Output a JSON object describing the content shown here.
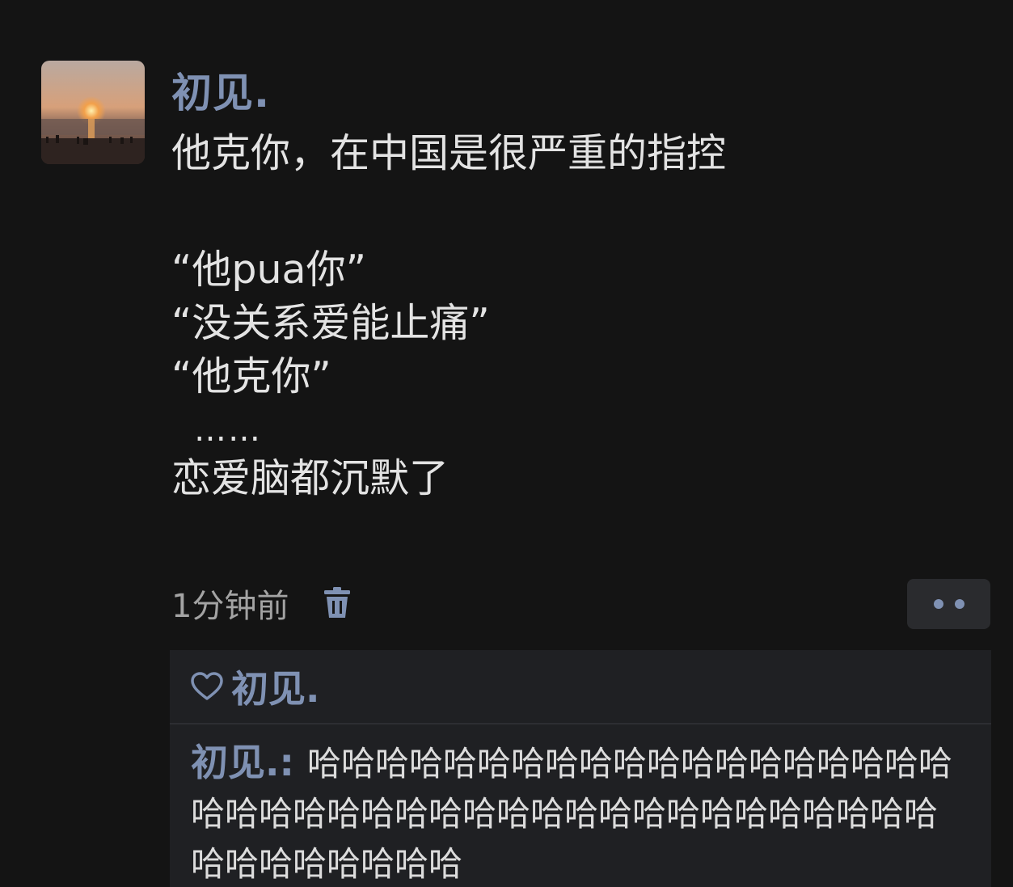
{
  "post": {
    "author": "初见.",
    "lines": [
      "他克你，在中国是很严重的指控",
      "",
      "“他pua你”",
      "“没关系爱能止痛”",
      "“他克你”",
      "……",
      "恋爱脑都沉默了"
    ],
    "timestamp": "1分钟前"
  },
  "likes": {
    "names": "初见."
  },
  "comment": {
    "author": "初见.",
    "separator": ": ",
    "text": "哈哈哈哈哈哈哈哈哈哈哈哈哈哈哈哈哈哈哈哈哈哈哈哈哈哈哈哈哈哈哈哈哈哈哈哈哈哈哈哈哈哈哈哈哈哈哈哈哈"
  },
  "colors": {
    "background": "#141414",
    "name_accent": "#7f91b3",
    "body_text": "#e3e3e3",
    "meta_text": "#a3a3a3",
    "reaction_panel": "#1f2023"
  },
  "icons": {
    "avatar": "sunset-photo",
    "delete": "trash-icon",
    "more": "ellipsis-icon",
    "like": "heart-outline-icon"
  }
}
